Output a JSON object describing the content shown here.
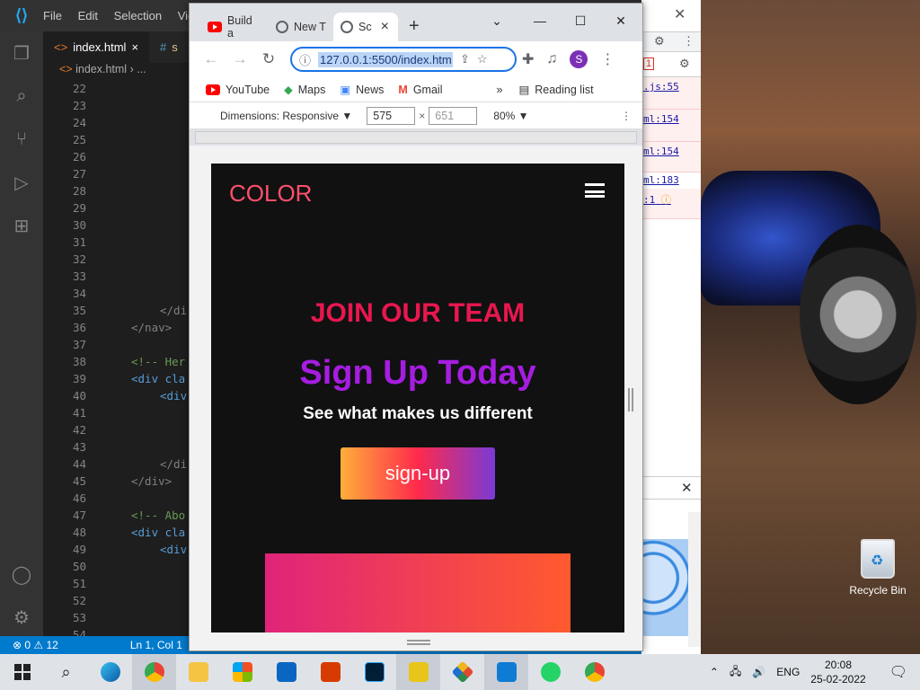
{
  "vscode": {
    "menu": [
      "File",
      "Edit",
      "Selection",
      "View"
    ],
    "tabs": [
      {
        "icon": "<>",
        "label": "index.html",
        "close": "×"
      },
      {
        "icon": "#",
        "label": "s"
      }
    ],
    "breadcrumb": {
      "icon": "<>",
      "file": "index.html",
      "sep": "›",
      "rest": "..."
    },
    "line_numbers": [
      "22",
      "23",
      "24",
      "25",
      "26",
      "27",
      "28",
      "29",
      "30",
      "31",
      "32",
      "33",
      "34",
      "35",
      "36",
      "37",
      "38",
      "39",
      "40",
      "41",
      "42",
      "43",
      "44",
      "45",
      "46",
      "47",
      "48",
      "49",
      "50",
      "51",
      "52",
      "53",
      "54"
    ],
    "code_lines": {
      "l35": "</di",
      "l36": "</nav>",
      "l38": "<!-- Her",
      "l39": "<div cla",
      "l40": "<div",
      "l44": "</di",
      "l45": "</div>",
      "l47": "<!-- Abo",
      "l48": "<div cla",
      "l49": "<div"
    },
    "status": {
      "errors": "⊗ 0",
      "warnings": "⚠ 12",
      "position": "Ln 1, Col 1"
    }
  },
  "devtools": {
    "refs": [
      ".js:55",
      "ml:154",
      "ml:154",
      "ml:183",
      ":1"
    ],
    "counter": "1"
  },
  "chrome": {
    "tabs": [
      {
        "label": "Build a"
      },
      {
        "label": "New T"
      },
      {
        "label": "Sc",
        "close": "×"
      }
    ],
    "new_tab": "+",
    "url": "127.0.0.1:5500/index.htm",
    "avatar": "S",
    "bookmarks": [
      "YouTube",
      "Maps",
      "News",
      "Gmail"
    ],
    "bookmarks_more": "»",
    "reading_list": "Reading list",
    "device": {
      "dimensions_label": "Dimensions: Responsive ▼",
      "width": "575",
      "times": "×",
      "height": "651",
      "zoom": "80% ▼"
    }
  },
  "site": {
    "brand": "COLOR",
    "hero_top": "JOIN OUR TEAM",
    "hero_title": "Sign Up Today",
    "hero_sub": "See what makes us different",
    "cta": "sign-up"
  },
  "desktop": {
    "recycle_bin": "Recycle Bin"
  },
  "taskbar": {
    "language": "ENG",
    "time": "20:08",
    "date": "25-02-2022"
  }
}
